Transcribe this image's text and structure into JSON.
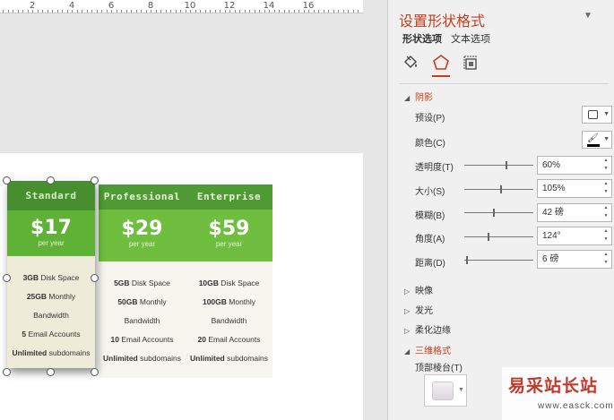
{
  "ruler": {
    "labels": [
      "2",
      "4",
      "6",
      "8",
      "10",
      "12",
      "14",
      "16"
    ]
  },
  "pricing": {
    "columns": [
      {
        "name": "Standard",
        "price": "$17",
        "period": "per year",
        "features": [
          {
            "bold": "3GB",
            "rest": " Disk Space"
          },
          {
            "bold": "25GB",
            "rest": " Monthly"
          },
          {
            "bold": "",
            "rest": "Bandwidth"
          },
          {
            "bold": "5",
            "rest": " Email Accounts"
          },
          {
            "bold": "Unlimited",
            "rest": " subdomains"
          }
        ]
      },
      {
        "name": "Professional",
        "price": "$29",
        "period": "per year",
        "features": [
          {
            "bold": "5GB",
            "rest": " Disk Space"
          },
          {
            "bold": "50GB",
            "rest": " Monthly"
          },
          {
            "bold": "",
            "rest": "Bandwidth"
          },
          {
            "bold": "10",
            "rest": " Email Accounts"
          },
          {
            "bold": "Unlimited",
            "rest": " subdomains"
          }
        ]
      },
      {
        "name": "Enterprise",
        "price": "$59",
        "period": "per year",
        "features": [
          {
            "bold": "10GB",
            "rest": " Disk Space"
          },
          {
            "bold": "100GB",
            "rest": " Monthly"
          },
          {
            "bold": "",
            "rest": "Bandwidth"
          },
          {
            "bold": "20",
            "rest": " Email Accounts"
          },
          {
            "bold": "Unlimited",
            "rest": " subdomains"
          }
        ]
      }
    ]
  },
  "pane": {
    "title": "设置形状格式",
    "tabs": {
      "shape": "形状选项",
      "text": "文本选项"
    },
    "icons": [
      "fill-line-icon",
      "effects-icon",
      "size-properties-icon"
    ],
    "sections": {
      "shadow": "阴影",
      "reflection": "映像",
      "glow": "发光",
      "soft_edges": "柔化边缘",
      "three_d_format": "三维格式"
    },
    "shadow": {
      "preset_label": "预设(P)",
      "color_label": "颜色(C)",
      "transparency_label": "透明度(T)",
      "transparency_value": "60%",
      "transparency_level": 0.6,
      "size_label": "大小(S)",
      "size_value": "105%",
      "size_level": 0.525,
      "blur_label": "模糊(B)",
      "blur_value": "42 磅",
      "blur_level": 0.42,
      "angle_label": "角度(A)",
      "angle_value": "124°",
      "angle_level": 0.344,
      "distance_label": "距离(D)",
      "distance_value": "6 磅",
      "distance_level": 0.03
    },
    "three_d": {
      "top_bevel_label": "顶部棱台(T)"
    },
    "colors": {
      "accent": "#c43e1c"
    }
  },
  "watermark": {
    "text": "易采站长站",
    "url": "www.easck.com"
  }
}
